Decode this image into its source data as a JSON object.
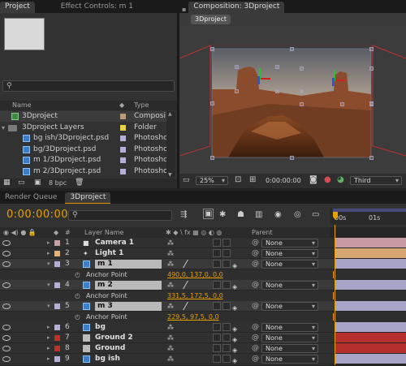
{
  "project_panel": {
    "tabs": [
      {
        "label": "Project"
      },
      {
        "label": "Effect Controls: m 1"
      }
    ],
    "columns": {
      "name": "Name",
      "type": "Type"
    },
    "items": [
      {
        "name": "3Dproject",
        "type": "Composi",
        "color": "#b89c7c",
        "icon": "composition-icon",
        "indent": 0
      },
      {
        "name": "3Dproject Layers",
        "type": "Folder",
        "color": "#e8d24a",
        "icon": "folder-icon",
        "indent": 0
      },
      {
        "name": "bg ish/3Dproject.psd",
        "type": "Photosho",
        "color": "#b5b0d8",
        "icon": "psd-file-icon",
        "indent": 1
      },
      {
        "name": "bg/3Dproject.psd",
        "type": "Photosho",
        "color": "#b5b0d8",
        "icon": "psd-file-icon",
        "indent": 1
      },
      {
        "name": "m 1/3Dproject.psd",
        "type": "Photosho",
        "color": "#b5b0d8",
        "icon": "psd-file-icon",
        "indent": 1
      },
      {
        "name": "m 2/3Dproject.psd",
        "type": "Photosho",
        "color": "#b5b0d8",
        "icon": "psd-file-icon",
        "indent": 1
      }
    ],
    "bit_depth": "8 bpc"
  },
  "composition_panel": {
    "tab": "Composition: 3Dproject",
    "comp_button": "3Dproject",
    "zoom": "25%",
    "timecode": "0:00:00:00",
    "view": "Third"
  },
  "timeline": {
    "tabs": [
      {
        "label": "Render Queue"
      },
      {
        "label": "3Dproject"
      }
    ],
    "current_time": "0:00:00:00",
    "search_placeholder": "",
    "ruler": {
      "start": "00s",
      "mark": "01s"
    },
    "columns": {
      "layer_name": "Layer Name",
      "parent": "Parent"
    },
    "layers": [
      {
        "kind": "layer",
        "num": "1",
        "name": "Camera 1",
        "label_color": "#c8a0a8",
        "icon": "camera-icon",
        "parent": "None",
        "bar_color": "#c89aa4"
      },
      {
        "kind": "layer",
        "num": "2",
        "name": "Light 1",
        "label_color": "#e8b070",
        "icon": "light-icon",
        "parent": "None",
        "bar_color": "#d6a673"
      },
      {
        "kind": "layer",
        "num": "3",
        "name": "m 1",
        "label_color": "#b5b0d8",
        "icon": "psd-file-icon",
        "parent": "None",
        "bar_color": "#a7a4c8",
        "selected": true
      },
      {
        "kind": "prop",
        "name": "Anchor Point",
        "value": "490,0, 137,0, 0,0"
      },
      {
        "kind": "layer",
        "num": "4",
        "name": "m 2",
        "label_color": "#b5b0d8",
        "icon": "psd-file-icon",
        "parent": "None",
        "bar_color": "#a7a4c8",
        "selected": true
      },
      {
        "kind": "prop",
        "name": "Anchor Point",
        "value": "331,5, 172,5, 0,0"
      },
      {
        "kind": "layer",
        "num": "5",
        "name": "m 3",
        "label_color": "#b5b0d8",
        "icon": "psd-file-icon",
        "parent": "None",
        "bar_color": "#a7a4c8",
        "selected": true
      },
      {
        "kind": "prop",
        "name": "Anchor Point",
        "value": "229,5, 97,5, 0,0"
      },
      {
        "kind": "layer",
        "num": "6",
        "name": "bg",
        "label_color": "#b5b0d8",
        "icon": "psd-file-icon",
        "parent": "None",
        "bar_color": "#a7a4c8"
      },
      {
        "kind": "layer",
        "num": "7",
        "name": "Ground 2",
        "label_color": "#c0302a",
        "icon": "solid-icon",
        "parent": "None",
        "bar_color": "#b5302c"
      },
      {
        "kind": "layer",
        "num": "8",
        "name": "Ground",
        "label_color": "#c0302a",
        "icon": "solid-icon",
        "parent": "None",
        "bar_color": "#b5302c"
      },
      {
        "kind": "layer",
        "num": "9",
        "name": "bg ish",
        "label_color": "#b5b0d8",
        "icon": "psd-file-icon",
        "parent": "None",
        "bar_color": "#a7a4c8"
      }
    ]
  }
}
